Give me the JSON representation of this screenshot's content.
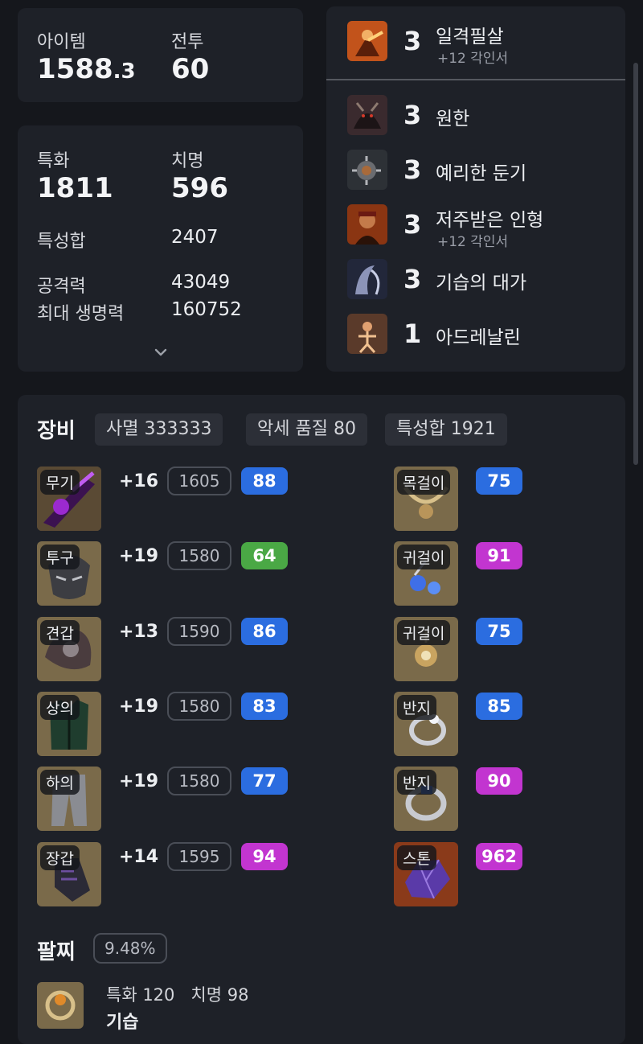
{
  "summary": {
    "item_level_label": "아이템",
    "item_level_int": "1588",
    "item_level_frac": ".3",
    "combat_label": "전투",
    "combat_value": "60"
  },
  "stats": {
    "specialization_label": "특화",
    "specialization_value": "1811",
    "crit_label": "치명",
    "crit_value": "596",
    "total_label": "특성합",
    "total_value": "2407",
    "attack_label": "공격력",
    "attack_value": "43049",
    "hp_label": "최대 생명력",
    "hp_value": "160752"
  },
  "engravings": [
    {
      "level": "3",
      "name": "일격필살",
      "sub": "+12 각인서",
      "icon": "fist-strike-icon"
    },
    {
      "level": "3",
      "name": "원한",
      "sub": "",
      "icon": "demon-grudge-icon"
    },
    {
      "level": "3",
      "name": "예리한 둔기",
      "sub": "",
      "icon": "spiked-mace-icon"
    },
    {
      "level": "3",
      "name": "저주받은 인형",
      "sub": "+12 각인서",
      "icon": "cursed-doll-icon"
    },
    {
      "level": "3",
      "name": "기습의 대가",
      "sub": "",
      "icon": "ambush-master-icon"
    },
    {
      "level": "1",
      "name": "아드레날린",
      "sub": "",
      "icon": "adrenaline-icon"
    }
  ],
  "equipment": {
    "title": "장비",
    "chips": [
      "사멸 333333",
      "악세 품질 80",
      "특성합 1921"
    ],
    "gear": [
      {
        "slot": "무기",
        "refine": "+16",
        "ilvl": "1605",
        "quality": "88",
        "quality_color": "#2b6de0"
      },
      {
        "slot": "투구",
        "refine": "+19",
        "ilvl": "1580",
        "quality": "64",
        "quality_color": "#4aa845"
      },
      {
        "slot": "견갑",
        "refine": "+13",
        "ilvl": "1590",
        "quality": "86",
        "quality_color": "#2b6de0"
      },
      {
        "slot": "상의",
        "refine": "+19",
        "ilvl": "1580",
        "quality": "83",
        "quality_color": "#2b6de0"
      },
      {
        "slot": "하의",
        "refine": "+19",
        "ilvl": "1580",
        "quality": "77",
        "quality_color": "#2b6de0"
      },
      {
        "slot": "장갑",
        "refine": "+14",
        "ilvl": "1595",
        "quality": "94",
        "quality_color": "#c235d0"
      }
    ],
    "accessories": [
      {
        "slot": "목걸이",
        "quality": "75",
        "quality_color": "#2b6de0"
      },
      {
        "slot": "귀걸이",
        "quality": "91",
        "quality_color": "#c235d0"
      },
      {
        "slot": "귀걸이",
        "quality": "75",
        "quality_color": "#2b6de0"
      },
      {
        "slot": "반지",
        "quality": "85",
        "quality_color": "#2b6de0"
      },
      {
        "slot": "반지",
        "quality": "90",
        "quality_color": "#c235d0"
      },
      {
        "slot": "스톤",
        "quality": "962",
        "quality_color": "#c235d0"
      }
    ]
  },
  "bracelet": {
    "title": "팔찌",
    "percent": "9.48%",
    "stats_line": "특화 120   치명 98",
    "effect": "기습"
  }
}
